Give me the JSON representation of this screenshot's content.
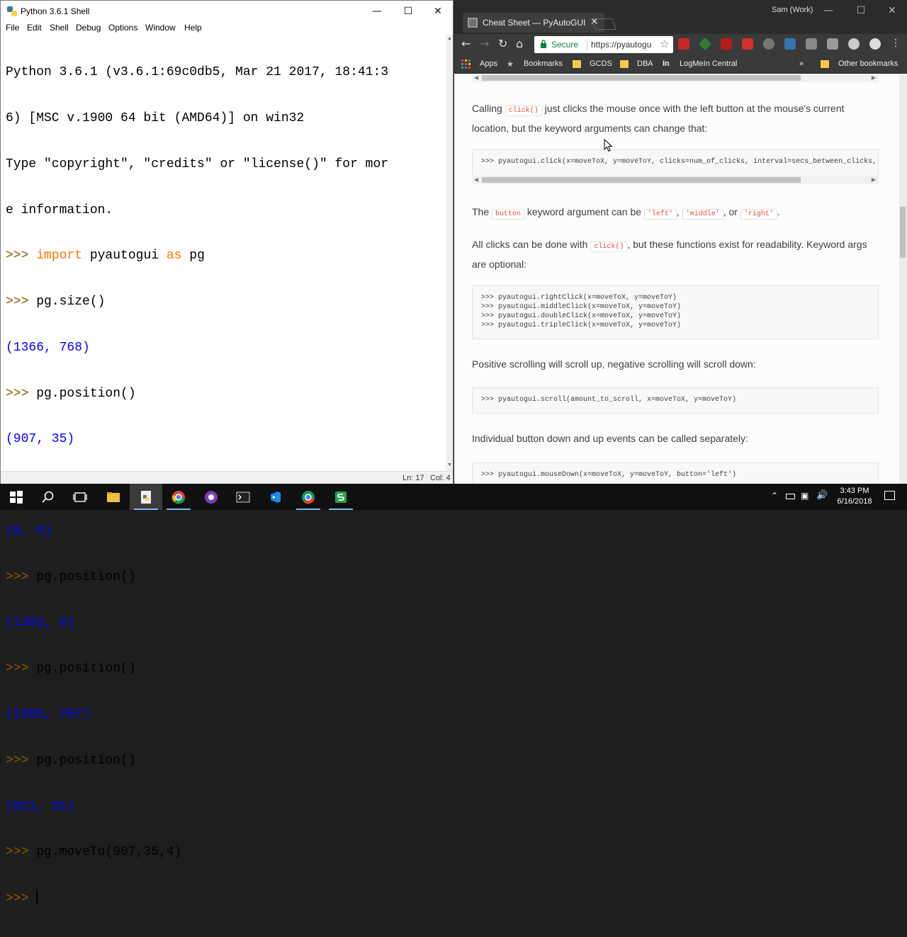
{
  "idle": {
    "title": "Python 3.6.1 Shell",
    "menu": [
      "File",
      "Edit",
      "Shell",
      "Debug",
      "Options",
      "Window",
      "Help"
    ],
    "banner": [
      "Python 3.6.1 (v3.6.1:69c0db5, Mar 21 2017, 18:41:3",
      "6) [MSC v.1900 64 bit (AMD64)] on win32",
      "Type \"copyright\", \"credits\" or \"license()\" for mor",
      "e information."
    ],
    "prompt": ">>> ",
    "import_kw": "import",
    "import_mod": " pyautogui ",
    "as_kw": "as",
    "import_alias": " pg",
    "cmd_size": "pg.size()",
    "out_size": "(1366, 768)",
    "cmd_position": "pg.position()",
    "out_pos_1": "(907, 35)",
    "out_pos_2": "(0, 0)",
    "out_pos_3": "(1365, 0)",
    "out_pos_4": "(1365, 767)",
    "out_pos_5": "(911, 31)",
    "cmd_moveto": "pg.moveTo(907,35,4)",
    "status_ln": "Ln: 17",
    "status_col": "Col: 4"
  },
  "chrome": {
    "tab_title": "Cheat Sheet — PyAutoGUI",
    "profile": "Sam (Work)",
    "secure_label": "Secure",
    "url": "https://pyautogui.readthedocs.io/en/latest/cheatsheet.html",
    "bookmarks": [
      "Apps",
      "Bookmarks",
      "GCDS",
      "DBA",
      "LogMeIn Central",
      "Other bookmarks"
    ],
    "page": {
      "p1_a": "Calling ",
      "p1_code": "click()",
      "p1_b": " just clicks the mouse once with the left button at the mouse's current location, but the keyword arguments can change that:",
      "code1": ">>> pyautogui.click(x=moveToX, y=moveToY, clicks=num_of_clicks, interval=secs_between_clicks, button='left')",
      "p2_a": "The ",
      "p2_code": "button",
      "p2_b": " keyword argument can be ",
      "p2_c1": "'left'",
      "p2_comma1": ", ",
      "p2_c2": "'middle'",
      "p2_or": ", or ",
      "p2_c3": "'right'",
      "p2_end": ".",
      "p3_a": "All clicks can be done with ",
      "p3_code": "click()",
      "p3_b": ", but these functions exist for readability. Keyword args are optional:",
      "code2": ">>> pyautogui.rightClick(x=moveToX, y=moveToY)\n>>> pyautogui.middleClick(x=moveToX, y=moveToY)\n>>> pyautogui.doubleClick(x=moveToX, y=moveToY)\n>>> pyautogui.tripleClick(x=moveToX, y=moveToY)",
      "p4": "Positive scrolling will scroll up, negative scrolling will scroll down:",
      "code3": ">>> pyautogui.scroll(amount_to_scroll, x=moveToX, y=moveToY)",
      "p5": "Individual button down and up events can be called separately:",
      "code4": ">>> pyautogui.mouseDown(x=moveToX, y=moveToY, button='left')"
    }
  },
  "taskbar": {
    "time": "3:43 PM",
    "date": "6/16/2018"
  }
}
